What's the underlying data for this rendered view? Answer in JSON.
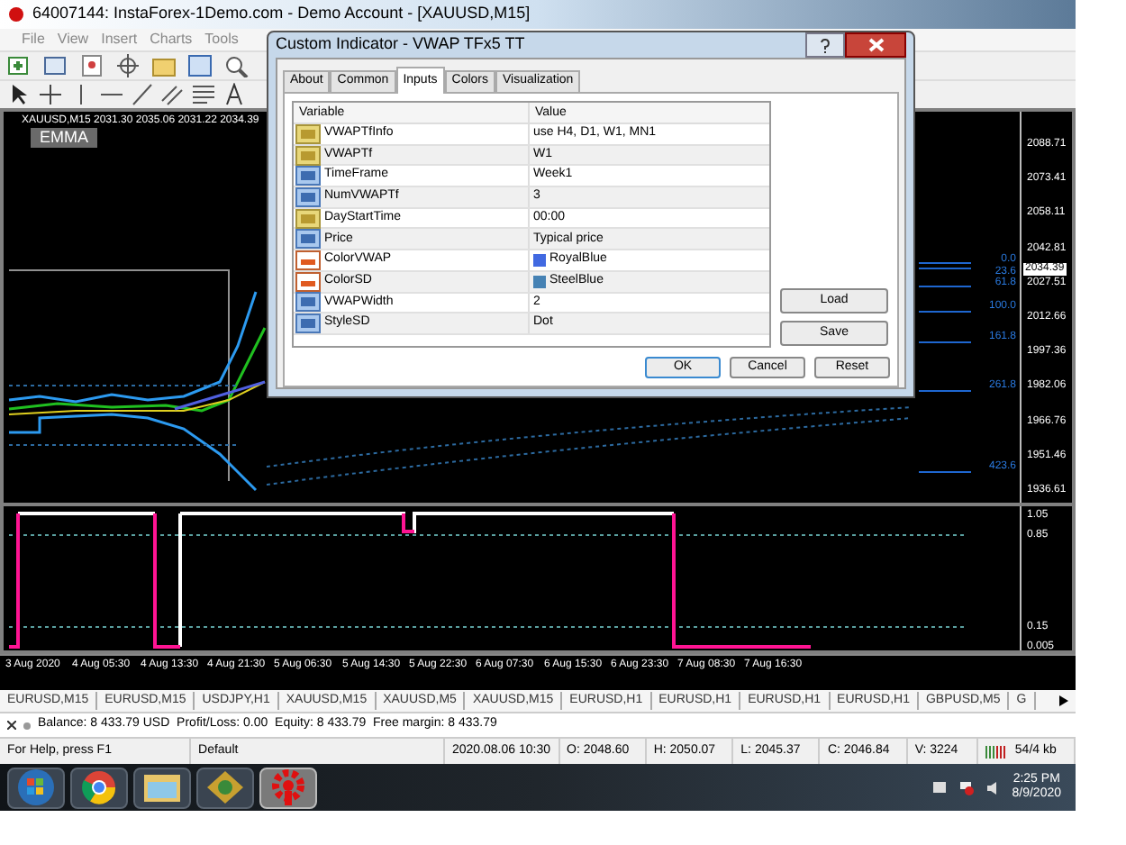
{
  "window": {
    "title": "64007144: InstaForex-1Demo.com - Demo Account - [XAUUSD,M15]"
  },
  "menu": [
    "File",
    "View",
    "Insert",
    "Charts",
    "Tools"
  ],
  "chart": {
    "header": "XAUUSD,M15  2031.30 2035.06 2031.22 2034.39",
    "button": "EMMA",
    "price_labels": [
      "2088.71",
      "2073.41",
      "2058.11",
      "2042.81",
      "2027.51",
      "2012.66",
      "1997.36",
      "1982.06",
      "1966.76",
      "1951.46",
      "1936.61"
    ],
    "current_price": "2034.39",
    "fib_levels": [
      "0.0",
      "23.6",
      "61.8",
      "100.0",
      "161.8",
      "261.8",
      "423.6"
    ]
  },
  "indicator": {
    "levels": [
      "1.05",
      "0.85",
      "0.15",
      "0.005"
    ]
  },
  "time_labels": [
    "3 Aug 2020",
    "4 Aug 05:30",
    "4 Aug 13:30",
    "4 Aug 21:30",
    "5 Aug 06:30",
    "5 Aug 14:30",
    "5 Aug 22:30",
    "6 Aug 07:30",
    "6 Aug 15:30",
    "6 Aug 23:30",
    "7 Aug 08:30",
    "7 Aug 16:30"
  ],
  "chart_tabs": [
    "EURUSD,M15",
    "EURUSD,M15",
    "USDJPY,H1",
    "XAUUSD,M15",
    "XAUUSD,M5",
    "XAUUSD,M15",
    "EURUSD,H1",
    "EURUSD,H1",
    "EURUSD,H1",
    "EURUSD,H1",
    "GBPUSD,M5",
    "G"
  ],
  "terminal": "Balance: 8 433.79 USD  Profit/Loss: 0.00  Equity: 8 433.79  Free margin: 8 433.79",
  "status_bar": [
    "For Help, press F1",
    "Default",
    "2020.08.06 10:30",
    "O: 2048.60",
    "H: 2050.07",
    "L: 2045.37",
    "C: 2046.84",
    "V: 3224",
    "54/4 kb"
  ],
  "taskbar": {
    "apps": [
      {
        "kind": "start",
        "selected": false
      },
      {
        "kind": "browser",
        "selected": false
      },
      {
        "kind": "folder",
        "selected": false
      },
      {
        "kind": "app",
        "selected": false
      },
      {
        "kind": "gear",
        "selected": true
      }
    ],
    "time": "2:25 PM",
    "date": "8/9/2020"
  },
  "dialog": {
    "title": "Custom Indicator - VWAP TFx5 TT",
    "tabs": [
      {
        "label": "About",
        "selected": false
      },
      {
        "label": "Common",
        "selected": false
      },
      {
        "label": "Inputs",
        "selected": true
      },
      {
        "label": "Colors",
        "selected": false
      },
      {
        "label": "Visualization",
        "selected": false
      }
    ],
    "columns": [
      "Variable",
      "Value"
    ],
    "rows": [
      {
        "kind": "text",
        "variable": "VWAPTfInfo",
        "value": "use H4, D1, W1, MN1"
      },
      {
        "kind": "text",
        "variable": "VWAPTf",
        "value": "W1"
      },
      {
        "kind": "number",
        "variable": "TimeFrame",
        "value": "Week1"
      },
      {
        "kind": "number",
        "variable": "NumVWAPTf",
        "value": "3"
      },
      {
        "kind": "text",
        "variable": "DayStartTime",
        "value": "00:00"
      },
      {
        "kind": "number",
        "variable": "Price",
        "value": "Typical price"
      },
      {
        "kind": "color",
        "variable": "ColorVWAP",
        "value": "RoyalBlue",
        "color": "#4169e1"
      },
      {
        "kind": "color",
        "variable": "ColorSD",
        "value": "SteelBlue",
        "color": "#4682b4"
      },
      {
        "kind": "number",
        "variable": "VWAPWidth",
        "value": "2"
      },
      {
        "kind": "number",
        "variable": "StyleSD",
        "value": "Dot"
      }
    ],
    "side_buttons": [
      "Load",
      "Save"
    ],
    "buttons": [
      "OK",
      "Cancel",
      "Reset"
    ]
  }
}
